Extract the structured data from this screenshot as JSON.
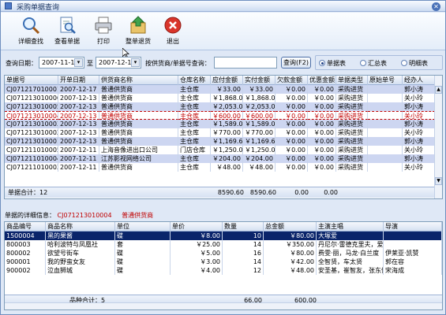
{
  "window": {
    "title": "采购单据查询",
    "close_glyph": "✕"
  },
  "toolbar": [
    {
      "label": "详细查找",
      "icon": "magnifier-icon"
    },
    {
      "label": "查看单据",
      "icon": "document-magnifier-icon"
    },
    {
      "label": "打印",
      "icon": "printer-icon"
    },
    {
      "label": "整单退货",
      "icon": "return-goods-icon"
    },
    {
      "label": "退出",
      "icon": "exit-icon"
    }
  ],
  "filter": {
    "date_label": "查询日期：",
    "date_from": "2007-11-17",
    "to_label": "至",
    "date_to": "2007-12-17",
    "search_label": "按供货商/单据号查询：",
    "search_value": "",
    "query_button": "查询(F2)",
    "radios": [
      {
        "label": "单据表",
        "checked": true
      },
      {
        "label": "汇总表",
        "checked": false
      },
      {
        "label": "明细表",
        "checked": false
      }
    ]
  },
  "orders": {
    "columns": [
      "单据号",
      "开单日期",
      "供货商名称",
      "仓库名称",
      "应付金额",
      "实付金额",
      "欠款金额",
      "优惠金额",
      "单据类型",
      "原始单号",
      "经办人"
    ],
    "rows": [
      [
        "CJ071217010001",
        "2007-12-17",
        "普通供货商",
        "主仓库",
        "￥33.00",
        "￥33.00",
        "￥0.00",
        "￥0.00",
        "采购进货",
        "",
        "郭小涛"
      ],
      [
        "CJ071213010006",
        "2007-12-13",
        "普通供货商",
        "主仓库",
        "￥1,868.0",
        "￥1,868.0",
        "￥0.00",
        "￥0.00",
        "采购进货",
        "",
        "关小玲"
      ],
      [
        "CJ071213010005",
        "2007-12-13",
        "普通供货商",
        "主仓库",
        "￥2,053.0",
        "￥2,053.0",
        "￥0.00",
        "￥0.00",
        "采购进货",
        "",
        "郭小涛"
      ],
      [
        "CJ071213010004",
        "2007-12-13",
        "普通供货商",
        "主仓库",
        "￥600.00",
        "￥600.00",
        "￥0.00",
        "￥0.00",
        "采购进货",
        "",
        "关小玲"
      ],
      [
        "CJ071213010003",
        "2007-12-13",
        "普通供货商",
        "主仓库",
        "￥1,589.0",
        "￥1,589.0",
        "￥0.00",
        "￥0.00",
        "采购进货",
        "",
        "郭小涛"
      ],
      [
        "CJ071213010002",
        "2007-12-13",
        "普通供货商",
        "主仓库",
        "￥770.00",
        "￥770.00",
        "￥0.00",
        "￥0.00",
        "采购进货",
        "",
        "关小玲"
      ],
      [
        "CJ071213010001",
        "2007-12-13",
        "普通供货商",
        "主仓库",
        "￥1,169.6",
        "￥1,169.6",
        "￥0.00",
        "￥0.00",
        "采购进货",
        "",
        "郭小涛"
      ],
      [
        "CJ071211010005",
        "2007-12-11",
        "上海音像进出口公司",
        "门店仓库",
        "￥1,250.0",
        "￥1,250.0",
        "￥0.00",
        "￥0.00",
        "采购进货",
        "",
        "关小玲"
      ],
      [
        "CJ071211010004",
        "2007-12-11",
        "江苏影视网络公司",
        "主仓库",
        "￥204.00",
        "￥204.00",
        "￥0.00",
        "￥0.00",
        "采购进货",
        "",
        "郭小涛"
      ],
      [
        "CJ071211010003",
        "2007-12-11",
        "普通供货商",
        "主仓库",
        "￥48.00",
        "￥48.00",
        "￥0.00",
        "￥0.00",
        "采购进货",
        "",
        "关小玲"
      ]
    ],
    "selected_row": 3,
    "summary": {
      "count_label": "单据合计：12",
      "payable_total": "8590.60",
      "paid_total": "8590.60",
      "debt_total": "0.00",
      "discount_total": "0.00"
    }
  },
  "detail": {
    "label": "单据的详细信息：",
    "order_no": "CJ071213010004",
    "supplier": "普通供货商",
    "columns": [
      "商品编号",
      "商品名称",
      "单位",
      "单价",
      "数量",
      "总金额",
      "主演主唱",
      "导演"
    ],
    "rows": [
      [
        "1500004",
        "黑的果酱",
        "碟",
        "￥8.00",
        "10",
        "￥80.00",
        "大塚爱",
        ""
      ],
      [
        "800003",
        "哈利波特与凤凰社",
        "套",
        "￥25.00",
        "14",
        "￥350.00",
        "丹尼尔·雷德克里夫，爱",
        ""
      ],
      [
        "800002",
        "欲望号街车",
        "碟",
        "￥5.00",
        "16",
        "￥80.00",
        "费雯·丽，马龙·白兰度",
        "伊莱亚·凯赞"
      ],
      [
        "900001",
        "我的野蛮女友",
        "碟",
        "￥3.00",
        "14",
        "￥42.00",
        "全智贤，车太贤",
        "郭在容"
      ],
      [
        "900002",
        "泣血狮城",
        "碟",
        "￥4.00",
        "12",
        "￥48.00",
        "安圣基，崔智友，张东健",
        "宋海成"
      ]
    ],
    "selected_row": 0,
    "summary": {
      "count_label": "品种合计：5",
      "quantity_total": "66.00",
      "amount_total": "600.00"
    }
  },
  "colors": {
    "selected_row": "#0a246a",
    "highlight_text": "#c00000",
    "stripe": "#cdd6f1"
  }
}
